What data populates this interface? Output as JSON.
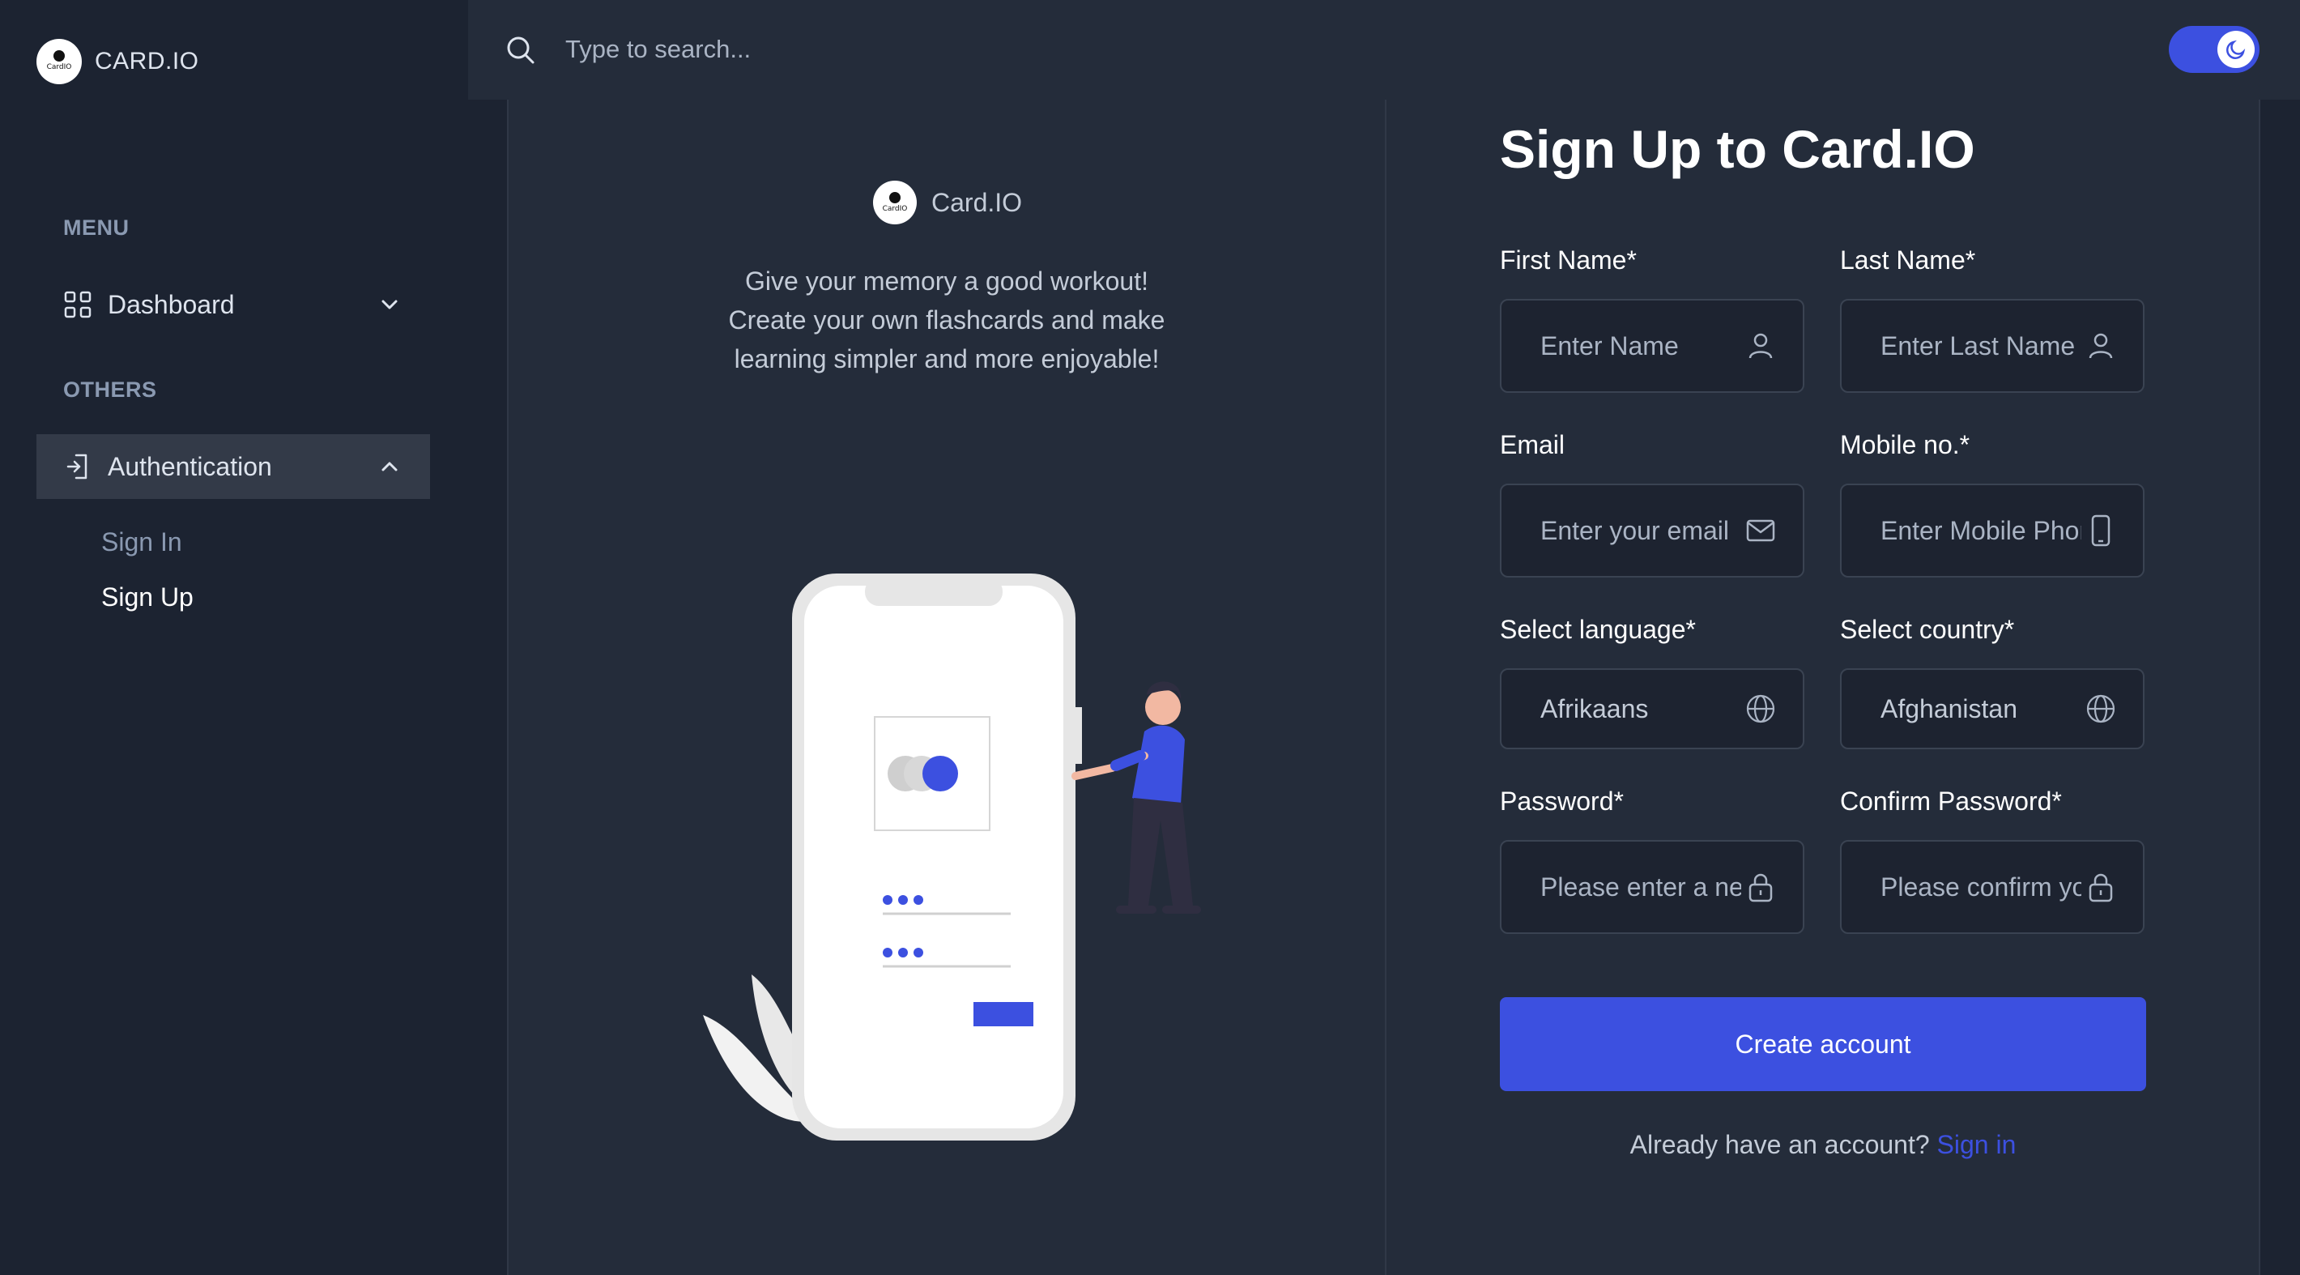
{
  "brand": {
    "name": "CARD.IO",
    "logo_text": "CardIO"
  },
  "sidebar": {
    "menu_label": "MENU",
    "others_label": "OTHERS",
    "dashboard": {
      "label": "Dashboard",
      "icon": "grid-icon"
    },
    "authentication": {
      "label": "Authentication",
      "icon": "login-icon",
      "sub_items": [
        {
          "label": "Sign In"
        },
        {
          "label": "Sign Up"
        }
      ]
    }
  },
  "header": {
    "search_placeholder": "Type to search...",
    "theme_toggle_icon": "moon-icon"
  },
  "left_pane": {
    "brand_name": "Card.IO",
    "tagline_lines": [
      "Give your memory a good workout!",
      "Create your own flashcards and make",
      "learning simpler and more enjoyable!"
    ]
  },
  "form": {
    "title": "Sign Up to Card.IO",
    "first_name": {
      "label": "First Name*",
      "placeholder": "Enter Name",
      "icon": "user-icon"
    },
    "last_name": {
      "label": "Last Name*",
      "placeholder": "Enter Last Name",
      "icon": "user-icon"
    },
    "email": {
      "label": "Email",
      "placeholder": "Enter your email",
      "icon": "mail-icon"
    },
    "mobile": {
      "label": "Mobile no.*",
      "placeholder": "Enter Mobile Phone",
      "icon": "phone-icon"
    },
    "language": {
      "label": "Select language*",
      "value": "Afrikaans",
      "icon": "globe-icon"
    },
    "country": {
      "label": "Select country*",
      "value": "Afghanistan",
      "icon": "globe-icon"
    },
    "password": {
      "label": "Password*",
      "placeholder": "Please enter a new password",
      "icon": "lock-icon"
    },
    "confirm_password": {
      "label": "Confirm Password*",
      "placeholder": "Please confirm your password",
      "icon": "lock-icon"
    },
    "submit_label": "Create account",
    "signin_prompt": "Already have an account?",
    "signin_link": "Sign in"
  },
  "colors": {
    "accent": "#3c50e0",
    "background": "#1c2331",
    "panel": "#242c3a",
    "active_nav": "#333a48"
  }
}
